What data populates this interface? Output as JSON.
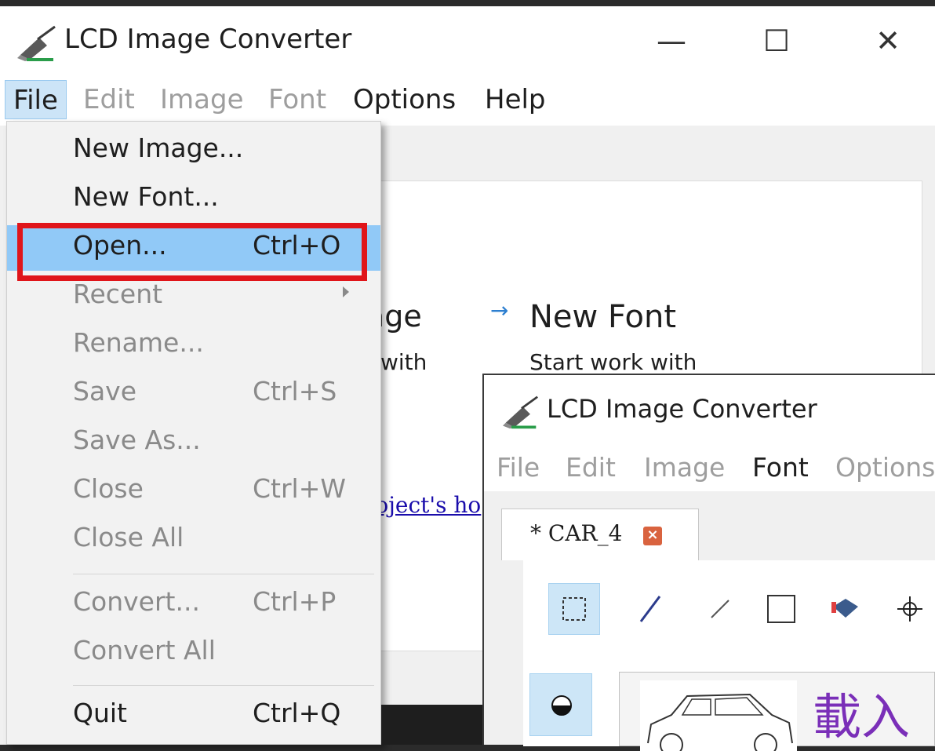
{
  "main_window": {
    "title": "LCD Image Converter",
    "controls": {
      "minimize": "—",
      "maximize": "☐",
      "close": "✕"
    },
    "menubar": [
      {
        "label": "File",
        "state": "active"
      },
      {
        "label": "Edit",
        "state": "disabled"
      },
      {
        "label": "Image",
        "state": "disabled"
      },
      {
        "label": "Font",
        "state": "disabled"
      },
      {
        "label": "Options",
        "state": "enabled"
      },
      {
        "label": "Help",
        "state": "enabled"
      }
    ]
  },
  "file_menu": {
    "items": [
      {
        "label": "New Image...",
        "shortcut": "",
        "state": "enabled"
      },
      {
        "label": "New Font...",
        "shortcut": "",
        "state": "enabled"
      },
      {
        "label": "Open...",
        "shortcut": "Ctrl+O",
        "state": "highlighted"
      },
      {
        "label": "Recent",
        "shortcut": "",
        "state": "disabled",
        "submenu": true
      },
      {
        "label": "Rename...",
        "shortcut": "",
        "state": "disabled"
      },
      {
        "label": "Save",
        "shortcut": "Ctrl+S",
        "state": "disabled"
      },
      {
        "label": "Save As...",
        "shortcut": "",
        "state": "disabled"
      },
      {
        "label": "Close",
        "shortcut": "Ctrl+W",
        "state": "disabled"
      },
      {
        "label": "Close All",
        "shortcut": "",
        "state": "disabled"
      },
      {
        "label": "Convert...",
        "shortcut": "Ctrl+P",
        "state": "disabled"
      },
      {
        "label": "Convert All",
        "shortcut": "",
        "state": "disabled"
      },
      {
        "label": "Quit",
        "shortcut": "Ctrl+Q",
        "state": "enabled"
      }
    ],
    "annotation_color": "#e0151a",
    "highlight_color": "#91c9f7"
  },
  "start_page": {
    "image_heading_fragment": "age",
    "image_sub_fragment": "with",
    "font_arrow": "→",
    "font_heading": "New Font",
    "font_sub": "Start work with",
    "link_fragment": "roject's ho"
  },
  "second_window": {
    "title": "LCD Image Converter",
    "menubar": [
      {
        "label": "File",
        "state": "disabled"
      },
      {
        "label": "Edit",
        "state": "disabled"
      },
      {
        "label": "Image",
        "state": "disabled"
      },
      {
        "label": "Font",
        "state": "enabled"
      },
      {
        "label": "Options",
        "state": "disabled"
      }
    ],
    "tab": {
      "label": "* CAR_4",
      "close": "×"
    },
    "cjk_text": "載入"
  }
}
